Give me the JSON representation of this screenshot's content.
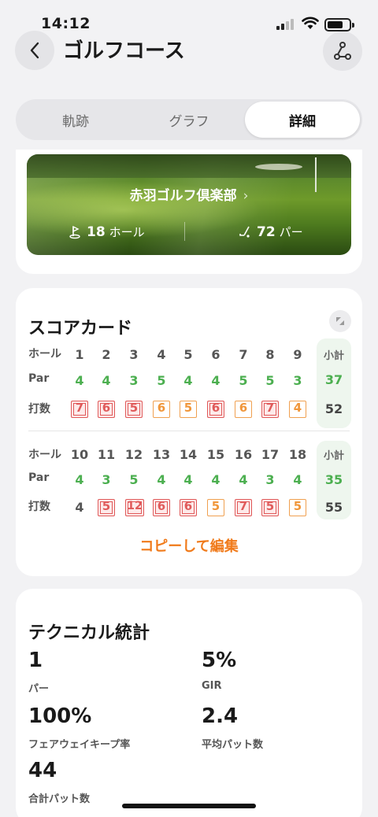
{
  "status_bar": {
    "time": "14:12"
  },
  "header": {
    "title": "ゴルフコース",
    "back_icon": "chevron-left-icon",
    "route_icon": "route-icon"
  },
  "tabs": [
    {
      "label": "軌跡",
      "selected": false
    },
    {
      "label": "グラフ",
      "selected": false
    },
    {
      "label": "詳細",
      "selected": true
    }
  ],
  "course": {
    "name": "赤羽ゴルフ倶楽部",
    "holes_value": "18",
    "holes_unit": "ホール",
    "par_value": "72",
    "par_unit": "パー"
  },
  "scorecard": {
    "title": "スコアカード",
    "row_labels": {
      "hole": "ホール",
      "par": "Par",
      "strokes": "打数"
    },
    "subtotal_label": "小計",
    "front": {
      "holes": [
        "1",
        "2",
        "3",
        "4",
        "5",
        "6",
        "7",
        "8",
        "9"
      ],
      "par": [
        "4",
        "4",
        "3",
        "5",
        "4",
        "4",
        "5",
        "5",
        "3"
      ],
      "strokes": [
        "7",
        "6",
        "5",
        "6",
        "5",
        "6",
        "6",
        "7",
        "4"
      ],
      "stroke_style": [
        "dbl",
        "dbl",
        "dbl",
        "bog",
        "bog",
        "dbl",
        "bog",
        "dbl",
        "bog"
      ],
      "par_subtotal": "37",
      "strokes_subtotal": "52"
    },
    "back": {
      "holes": [
        "10",
        "11",
        "12",
        "13",
        "14",
        "15",
        "16",
        "17",
        "18"
      ],
      "par": [
        "4",
        "3",
        "5",
        "4",
        "4",
        "4",
        "4",
        "3",
        "4"
      ],
      "strokes": [
        "4",
        "5",
        "12",
        "6",
        "6",
        "5",
        "7",
        "5",
        "5"
      ],
      "stroke_style": [
        "plain",
        "dbl",
        "dbl",
        "dbl",
        "dbl",
        "bog",
        "dbl",
        "dbl",
        "bog"
      ],
      "par_subtotal": "35",
      "strokes_subtotal": "55"
    },
    "copy_edit_label": "コピーして編集"
  },
  "stats": {
    "title": "テクニカル統計",
    "items": [
      {
        "value": "1",
        "label": "パー"
      },
      {
        "value": "5%",
        "label": "GIR"
      },
      {
        "value": "100%",
        "label": "フェアウェイキープ率"
      },
      {
        "value": "2.4",
        "label": "平均パット数"
      },
      {
        "value": "44",
        "label": "合計パット数"
      }
    ]
  },
  "colors": {
    "par_green": "#4caf50",
    "double_bogey_red": "#e05a5a",
    "bogey_orange": "#f0963a",
    "accent_orange": "#f07a1a"
  }
}
